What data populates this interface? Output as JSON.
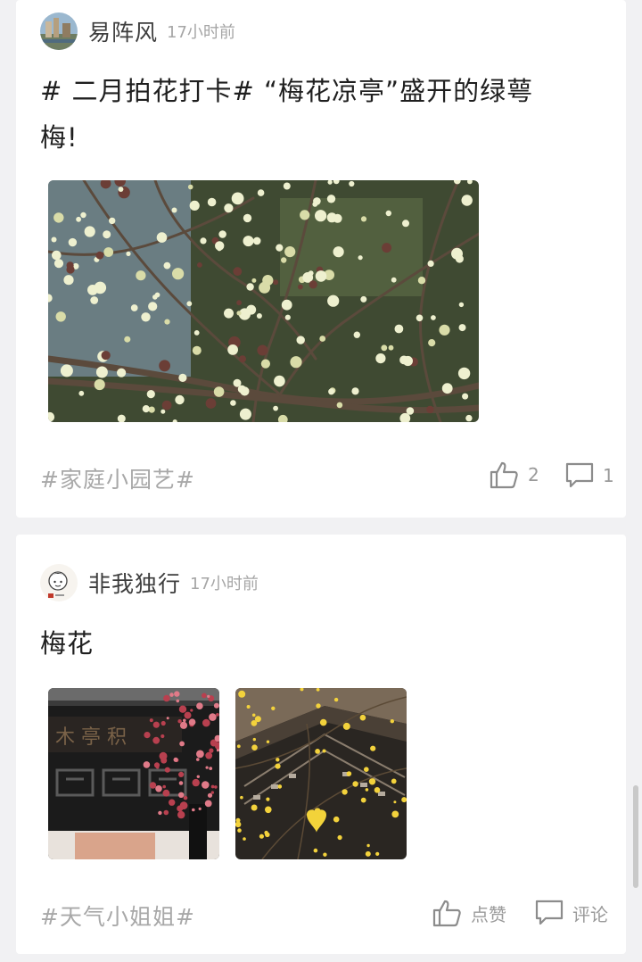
{
  "posts": [
    {
      "user": "易阵风",
      "time": "17小时前",
      "text_line1": "# 二月拍花打卡# “梅花凉亭”盛开的绿萼",
      "text_line2": "梅!",
      "tag": "#家庭小园艺#",
      "likes": "2",
      "comments": "1"
    },
    {
      "user": "非我独行",
      "time": "17小时前",
      "text_line1": "梅花",
      "tag": "#天气小姐姐#",
      "like_label": "点赞",
      "comment_label": "评论"
    }
  ],
  "icons": {
    "like": "thumb-up-icon",
    "comment": "comment-icon"
  },
  "colors": {
    "background": "#f1f1f3",
    "card": "#ffffff",
    "muted": "#a8a8a8"
  }
}
